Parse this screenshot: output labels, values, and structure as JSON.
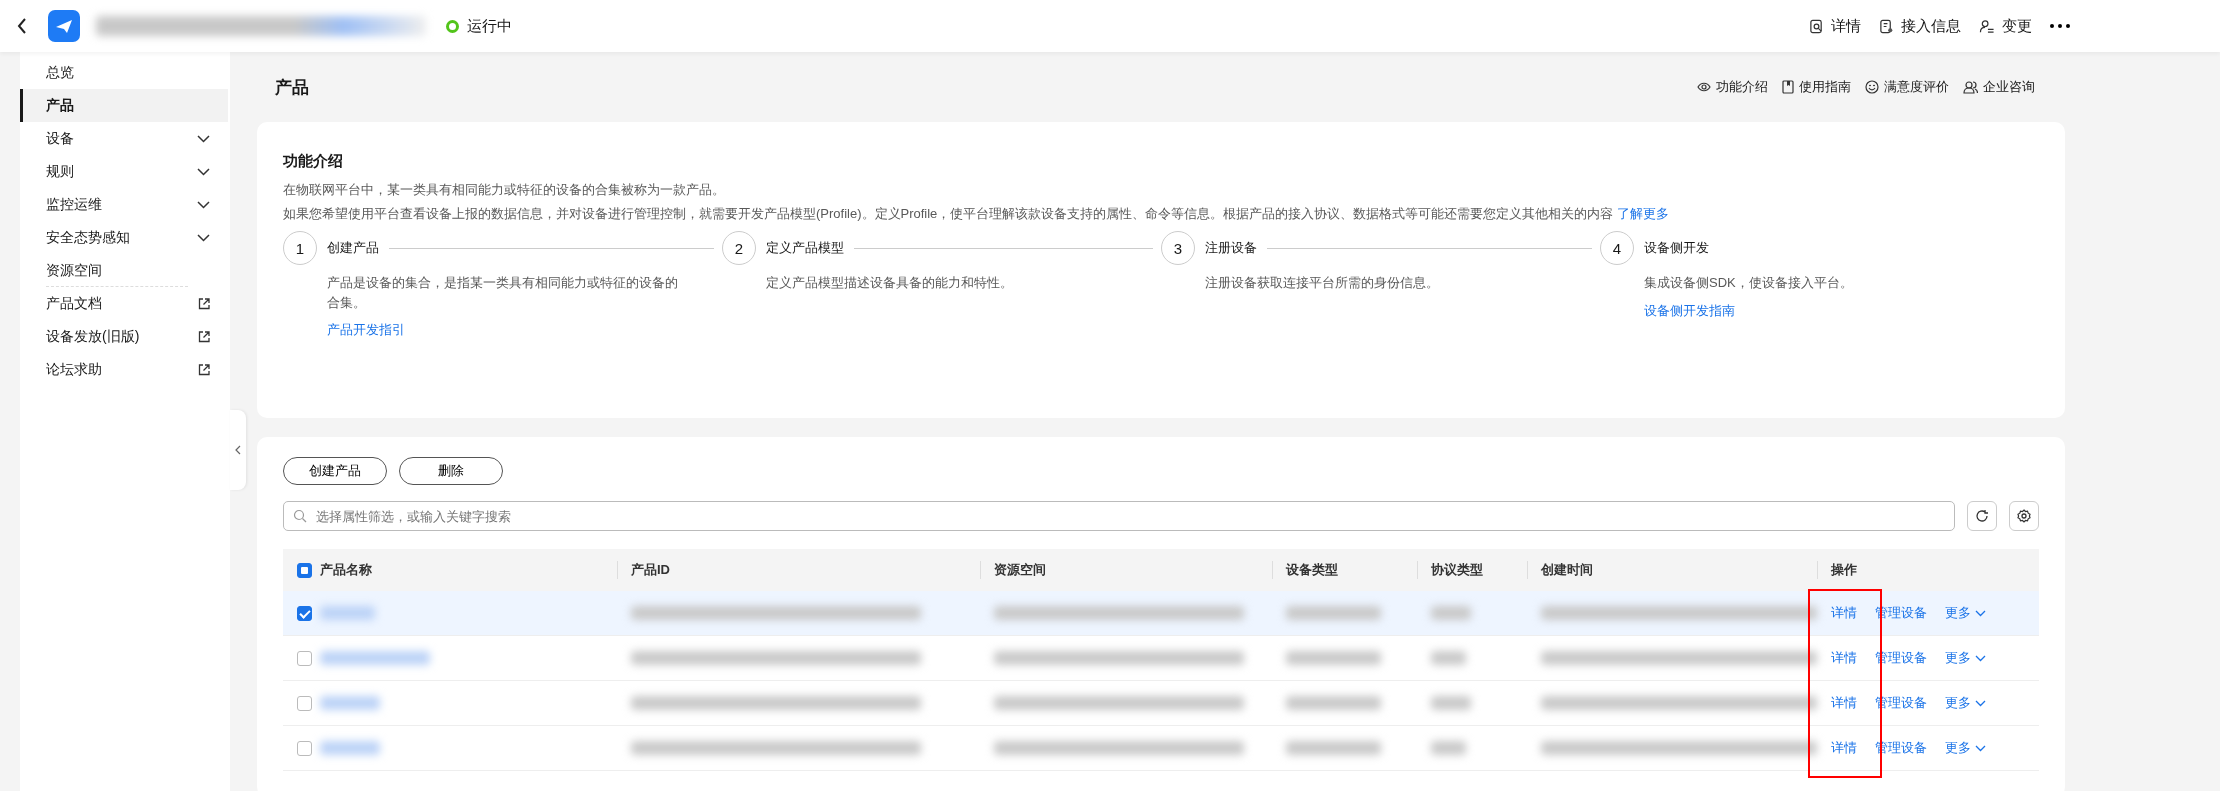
{
  "header": {
    "status": {
      "label": "运行中",
      "color": "#52c41a"
    },
    "actions": [
      {
        "label": "详情",
        "kind": "detail"
      },
      {
        "label": "接入信息",
        "kind": "doc"
      },
      {
        "label": "变更",
        "kind": "change"
      }
    ]
  },
  "sidebar": {
    "items": [
      {
        "label": "总览",
        "kind": "plain",
        "selected": false
      },
      {
        "label": "产品",
        "kind": "plain",
        "selected": true
      },
      {
        "label": "设备",
        "kind": "group",
        "selected": false,
        "expanded": false
      },
      {
        "label": "规则",
        "kind": "group",
        "selected": false,
        "expanded": false
      },
      {
        "label": "监控运维",
        "kind": "group",
        "selected": false,
        "expanded": false
      },
      {
        "label": "安全态势感知",
        "kind": "group",
        "selected": false,
        "expanded": false
      },
      {
        "label": "资源空间",
        "kind": "plain",
        "selected": false
      },
      {
        "label": "产品文档",
        "kind": "external",
        "selected": false
      },
      {
        "label": "设备发放(旧版)",
        "kind": "external",
        "selected": false
      },
      {
        "label": "论坛求助",
        "kind": "external",
        "selected": false
      }
    ]
  },
  "page": {
    "title": "产品",
    "help_links": [
      {
        "label": "功能介绍",
        "kind": "eye"
      },
      {
        "label": "使用指南",
        "kind": "book"
      },
      {
        "label": "满意度评价",
        "kind": "smile"
      },
      {
        "label": "企业咨询",
        "kind": "people"
      }
    ]
  },
  "intro": {
    "title": "功能介绍",
    "text": "在物联网平台中，某一类具有相同能力或特征的设备的合集被称为一款产品。",
    "text_2": "如果您希望使用平台查看设备上报的数据信息，并对设备进行管理控制，就需要开发产品模型(Profile)。定义Profile，使平台理解该款设备支持的属性、命令等信息。根据产品的接入协议、数据格式等可能还需要您定义其他相关的内容",
    "link": "了解更多",
    "steps": [
      {
        "number": "1",
        "title": "创建产品",
        "description": "产品是设备的集合，是指某一类具有相同能力或特征的设备的合集。",
        "link": "产品开发指引"
      },
      {
        "number": "2",
        "title": "定义产品模型",
        "description": "定义产品模型描述设备具备的能力和特性。"
      },
      {
        "number": "3",
        "title": "注册设备",
        "description": "注册设备获取连接平台所需的身份信息。"
      },
      {
        "number": "4",
        "title": "设备侧开发",
        "description": "集成设备侧SDK，使设备接入平台。",
        "link": "设备侧开发指南"
      }
    ]
  },
  "table": {
    "buttons": [
      "创建产品",
      "删除"
    ],
    "search": {
      "placeholder": "选择属性筛选，或输入关键字搜索"
    },
    "select_all": {
      "checked": true,
      "partial": true
    },
    "columns": [
      "产品名称",
      "产品ID",
      "资源空间",
      "设备类型",
      "协议类型",
      "创建时间",
      "操作"
    ],
    "rows": [
      {
        "selected": true,
        "actions": [
          "详情",
          "管理设备",
          "更多"
        ]
      },
      {
        "selected": false,
        "actions": [
          "详情",
          "管理设备",
          "更多"
        ]
      },
      {
        "selected": false,
        "actions": [
          "详情",
          "管理设备",
          "更多"
        ]
      },
      {
        "selected": false,
        "actions": [
          "详情",
          "管理设备",
          "更多"
        ]
      }
    ]
  }
}
